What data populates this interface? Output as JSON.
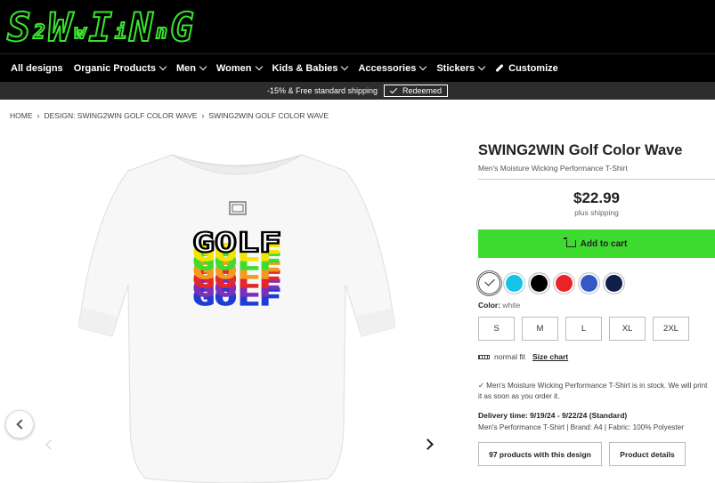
{
  "logo": {
    "text": "S2WINNG",
    "parts": [
      "S",
      "2",
      "W",
      "w",
      "I",
      "i",
      "N",
      "n",
      "G"
    ]
  },
  "nav": {
    "items": [
      {
        "label": "All designs",
        "dropdown": false
      },
      {
        "label": "Organic Products",
        "dropdown": true
      },
      {
        "label": "Men",
        "dropdown": true
      },
      {
        "label": "Women",
        "dropdown": true
      },
      {
        "label": "Kids & Babies",
        "dropdown": true
      },
      {
        "label": "Accessories",
        "dropdown": true
      },
      {
        "label": "Stickers",
        "dropdown": true
      }
    ],
    "customize": "Customize"
  },
  "promo": {
    "text": "-15% & Free standard shipping",
    "badge": "Redeemed"
  },
  "breadcrumb": [
    "HOME",
    "DESIGN: SWING2WIN GOLF COLOR WAVE",
    "SWING2WIN GOLF COLOR WAVE"
  ],
  "shirt_print": {
    "word": "GOLF",
    "colors": [
      "#000000",
      "#f5e400",
      "#3ddc2f",
      "#f39a1f",
      "#e6262b",
      "#7c2fb8",
      "#1f3cd6"
    ]
  },
  "product": {
    "title": "SWING2WIN Golf Color Wave",
    "subtitle": "Men's Moisture Wicking Performance T-Shirt",
    "price": "$22.99",
    "shipping": "plus shipping",
    "cart_label": "Add to cart",
    "swatches": [
      {
        "name": "white",
        "hex": "#ffffff",
        "selected": true
      },
      {
        "name": "turquoise",
        "hex": "#14c3e6",
        "selected": false
      },
      {
        "name": "black",
        "hex": "#000000",
        "selected": false
      },
      {
        "name": "red",
        "hex": "#e8232a",
        "selected": false
      },
      {
        "name": "royal blue",
        "hex": "#3558c6",
        "selected": false
      },
      {
        "name": "navy",
        "hex": "#0f1f4a",
        "selected": false
      }
    ],
    "color_label": "Color:",
    "color_value": "white",
    "sizes": [
      "S",
      "M",
      "L",
      "XL",
      "2XL"
    ],
    "fit": "normal fit",
    "size_chart": "Size chart",
    "stock": "Men's Moisture Wicking Performance T-Shirt is in stock. We will print it as soon as you order it.",
    "delivery": "Delivery time: 9/19/24 - 9/22/24 (Standard)",
    "details": "Men's Performance T-Shirt | Brand: A4 | Fabric: 100% Polyester",
    "buttons": {
      "products": "97 products with this design",
      "details": "Product details"
    }
  }
}
